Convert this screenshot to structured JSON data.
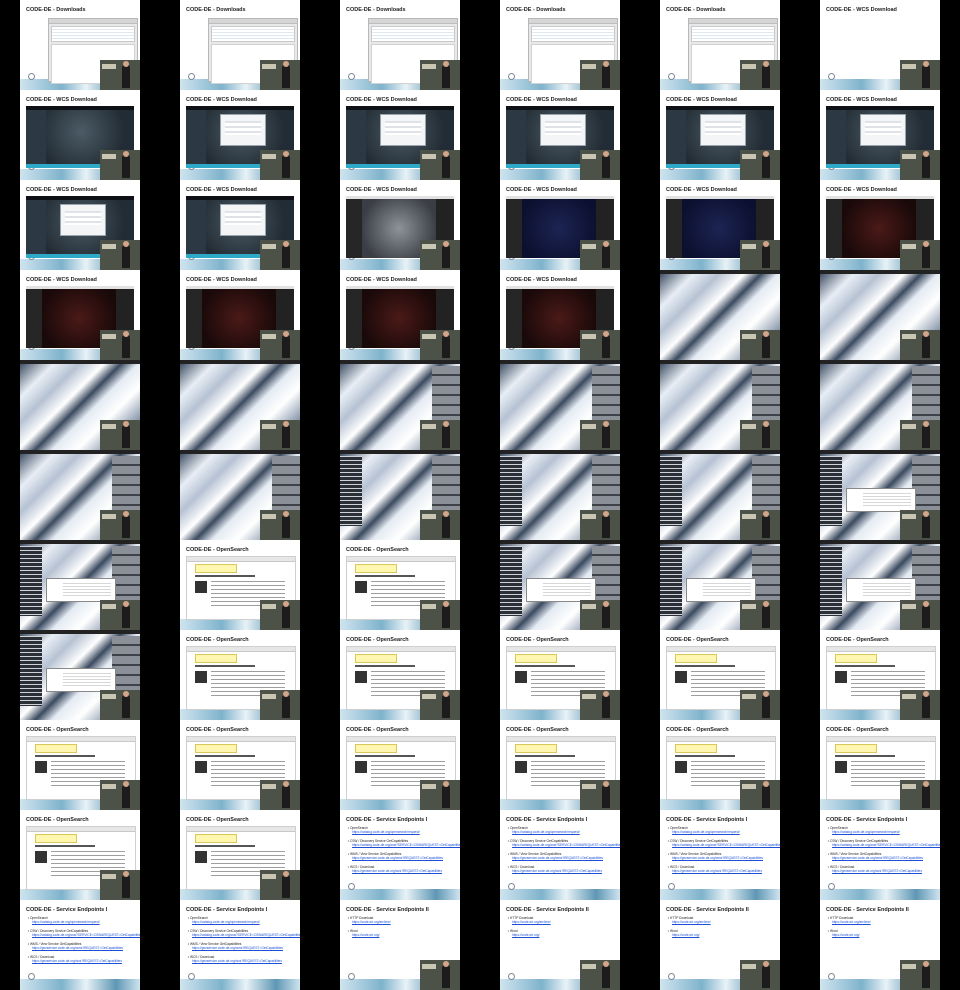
{
  "grid": {
    "columns": 6,
    "rows": 11
  },
  "colors": {
    "background": "#000000",
    "slide": "#ffffff",
    "link": "#1b4fd6"
  },
  "tiles": [
    {
      "title": "CODE-DE - Downloads",
      "content": "downloads"
    },
    {
      "title": "CODE-DE - Downloads",
      "content": "downloads"
    },
    {
      "title": "CODE-DE - Downloads",
      "content": "downloads"
    },
    {
      "title": "CODE-DE - Downloads",
      "content": "downloads"
    },
    {
      "title": "CODE-DE - Downloads",
      "content": "downloads"
    },
    {
      "title": "CODE-DE - WCS Download",
      "content": "blank"
    },
    {
      "title": "CODE-DE - WCS Download",
      "content": "wcs-map"
    },
    {
      "title": "CODE-DE - WCS Download",
      "content": "wcs-dialog"
    },
    {
      "title": "CODE-DE - WCS Download",
      "content": "wcs-dialog"
    },
    {
      "title": "CODE-DE - WCS Download",
      "content": "wcs-dialog"
    },
    {
      "title": "CODE-DE - WCS Download",
      "content": "wcs-dialog"
    },
    {
      "title": "CODE-DE - WCS Download",
      "content": "wcs-dialog"
    },
    {
      "title": "CODE-DE - WCS Download",
      "content": "wcs-dialog"
    },
    {
      "title": "CODE-DE - WCS Download",
      "content": "wcs-dialog"
    },
    {
      "title": "CODE-DE - WCS Download",
      "content": "dark-gray"
    },
    {
      "title": "CODE-DE - WCS Download",
      "content": "dark-blue"
    },
    {
      "title": "CODE-DE - WCS Download",
      "content": "dark-blue"
    },
    {
      "title": "CODE-DE - WCS Download",
      "content": "dark-red"
    },
    {
      "title": "CODE-DE - WCS Download",
      "content": "dark-red"
    },
    {
      "title": "CODE-DE - WCS Download",
      "content": "dark-red"
    },
    {
      "title": "CODE-DE - WCS Download",
      "content": "dark-red"
    },
    {
      "title": "CODE-DE - WCS Download",
      "content": "dark-red"
    },
    {
      "title": "",
      "content": "snow"
    },
    {
      "title": "",
      "content": "snow"
    },
    {
      "title": "",
      "content": "snow"
    },
    {
      "title": "",
      "content": "snow"
    },
    {
      "title": "",
      "content": "snow-panel"
    },
    {
      "title": "",
      "content": "snow-panel"
    },
    {
      "title": "",
      "content": "snow-panel"
    },
    {
      "title": "",
      "content": "snow-panel"
    },
    {
      "title": "",
      "content": "snow-panel"
    },
    {
      "title": "",
      "content": "snow-panel"
    },
    {
      "title": "",
      "content": "snow-both"
    },
    {
      "title": "",
      "content": "snow-both"
    },
    {
      "title": "",
      "content": "snow-both"
    },
    {
      "title": "",
      "content": "snow-popup"
    },
    {
      "title": "",
      "content": "snow-popup"
    },
    {
      "title": "CODE-DE - OpenSearch",
      "content": "opensearch"
    },
    {
      "title": "CODE-DE - OpenSearch",
      "content": "opensearch"
    },
    {
      "title": "",
      "content": "snow-popup"
    },
    {
      "title": "",
      "content": "snow-popup"
    },
    {
      "title": "",
      "content": "snow-popup"
    },
    {
      "title": "",
      "content": "snow-popup"
    },
    {
      "title": "CODE-DE - OpenSearch",
      "content": "opensearch"
    },
    {
      "title": "CODE-DE - OpenSearch",
      "content": "opensearch"
    },
    {
      "title": "CODE-DE - OpenSearch",
      "content": "opensearch"
    },
    {
      "title": "CODE-DE - OpenSearch",
      "content": "opensearch"
    },
    {
      "title": "CODE-DE - OpenSearch",
      "content": "opensearch"
    },
    {
      "title": "CODE-DE - OpenSearch",
      "content": "opensearch"
    },
    {
      "title": "CODE-DE - OpenSearch",
      "content": "opensearch"
    },
    {
      "title": "CODE-DE - OpenSearch",
      "content": "opensearch"
    },
    {
      "title": "CODE-DE - OpenSearch",
      "content": "opensearch"
    },
    {
      "title": "CODE-DE - OpenSearch",
      "content": "opensearch"
    },
    {
      "title": "CODE-DE - OpenSearch",
      "content": "opensearch"
    },
    {
      "title": "CODE-DE - OpenSearch",
      "content": "opensearch"
    },
    {
      "title": "CODE-DE - OpenSearch",
      "content": "opensearch"
    },
    {
      "title": "CODE-DE - Service Endpoints I",
      "content": "endpoints-1"
    },
    {
      "title": "CODE-DE - Service Endpoints I",
      "content": "endpoints-1"
    },
    {
      "title": "CODE-DE - Service Endpoints I",
      "content": "endpoints-1"
    },
    {
      "title": "CODE-DE - Service Endpoints I",
      "content": "endpoints-1"
    },
    {
      "title": "CODE-DE - Service Endpoints I",
      "content": "endpoints-1"
    },
    {
      "title": "CODE-DE - Service Endpoints I",
      "content": "endpoints-1"
    },
    {
      "title": "CODE-DE - Service Endpoints II",
      "content": "endpoints-2"
    },
    {
      "title": "CODE-DE - Service Endpoints II",
      "content": "endpoints-2"
    },
    {
      "title": "CODE-DE - Service Endpoints II",
      "content": "endpoints-2"
    },
    {
      "title": "CODE-DE - Service Endpoints II",
      "content": "endpoints-2"
    }
  ],
  "endpoints_1": [
    {
      "label": "OpenSearch",
      "url": "https://catalog.code-de.org/opensearch/request/"
    },
    {
      "label": "CSW / Discovery Service GetCapabilities",
      "url": "https://catalog.code-de.org/csw?SERVICE=CSW&REQUEST=GetCapabilities"
    },
    {
      "label": "WMS / View Service GetCapabilities",
      "url": "https://geoservice.code-de.org/wms?REQUEST=GetCapabilities"
    },
    {
      "label": "WCS / Download",
      "url": "https://geoservice.code-de.org/wcs?REQUEST=GetCapabilities"
    }
  ],
  "endpoints_2": [
    {
      "label": "HTTP Download",
      "url": "https://code-de.org/archive/"
    },
    {
      "label": "Word",
      "url": "https://code-de.org/"
    }
  ]
}
